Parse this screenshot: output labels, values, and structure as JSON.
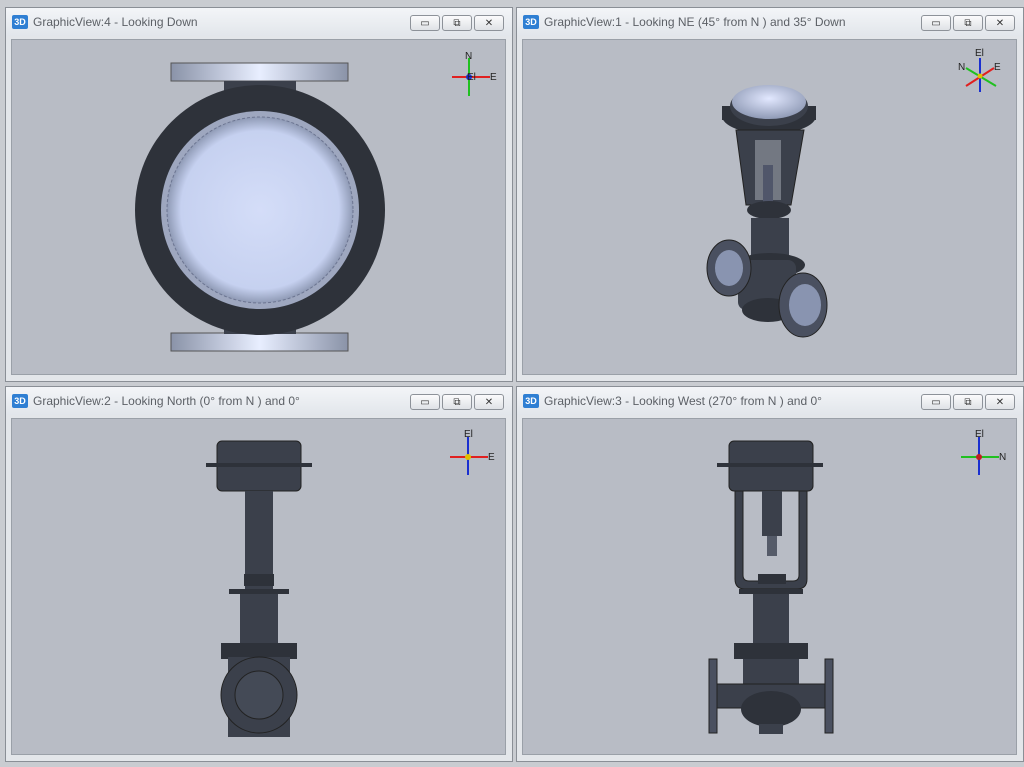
{
  "views": [
    {
      "id": "view4",
      "title": "GraphicView:4 - Looking Down",
      "badge": "3D",
      "axes": {
        "up": "N",
        "right": "E",
        "center": "El"
      }
    },
    {
      "id": "view1",
      "title": "GraphicView:1 - Looking NE (45° from N ) and 35° Down",
      "badge": "3D",
      "axes": {
        "up": "El",
        "left": "N",
        "right": "E"
      }
    },
    {
      "id": "view2",
      "title": "GraphicView:2 - Looking North (0° from N ) and 0°",
      "badge": "3D",
      "axes": {
        "up": "El",
        "right": "E"
      }
    },
    {
      "id": "view3",
      "title": "GraphicView:3 - Looking West (270° from N ) and 0°",
      "badge": "3D",
      "axes": {
        "up": "El",
        "right": "N"
      }
    }
  ],
  "window_buttons": {
    "minimize": "▭",
    "restore": "⧉",
    "close": "✕"
  },
  "colors": {
    "viewport_bg": "#b8bcc5",
    "metal_dark": "#3b404b",
    "metal_light": "#c8d4f0",
    "axis_red": "#e02020",
    "axis_green": "#20c020",
    "axis_blue": "#1a2fd0"
  },
  "icons": [
    "3d-badge-icon",
    "minimize-icon",
    "restore-icon",
    "close-icon",
    "axis-triad-icon"
  ]
}
